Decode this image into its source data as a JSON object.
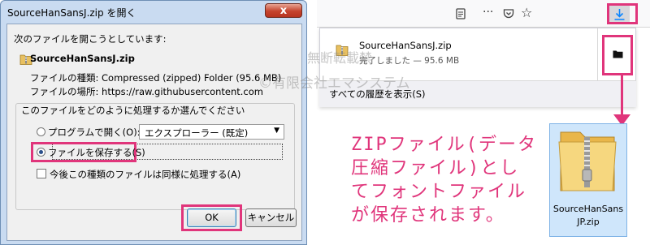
{
  "dialog": {
    "title": "SourceHanSansJ.zip を開く",
    "close_glyph": "x",
    "intro": "次のファイルを開こうとしています:",
    "file_name": "SourceHanSansJ.zip",
    "type_row": "ファイルの種類: Compressed (zipped) Folder (95.6 MB)",
    "location_row": "ファイルの場所: https://raw.githubusercontent.com",
    "question": "このファイルをどのように処理するか選んでください",
    "open_with_label": "プログラムで開く(O):",
    "combo_value": "エクスプローラー (既定)",
    "save_label": "ファイルを保存する(S)",
    "remember_label": "今後この種類のファイルは同様に処理する(A)",
    "ok_label": "OK",
    "cancel_label": "キャンセル"
  },
  "firefox": {
    "download_name": "SourceHanSansJ.zip",
    "download_status": "完了しました — 95.6 MB",
    "show_all": "すべての履歴を表示(S)",
    "toolbar_icons": [
      "reader-icon",
      "more-icon",
      "pocket-icon",
      "star-icon",
      "download-icon"
    ]
  },
  "file": {
    "label_line1": "SourceHanSans",
    "label_line2": "JP.zip"
  },
  "note": {
    "line1": "ZIPファイル(データ",
    "line2": "圧縮ファイル)とし",
    "line3": "てフォントファイル",
    "line4": "が保存されます。"
  },
  "watermark": {
    "line1": "無断転載禁",
    "line2": "©有限会社エマシステム"
  },
  "colors": {
    "highlight": "#e0357b",
    "dialog_frame": "#c9dbf1",
    "close_button": "#c5432d"
  }
}
